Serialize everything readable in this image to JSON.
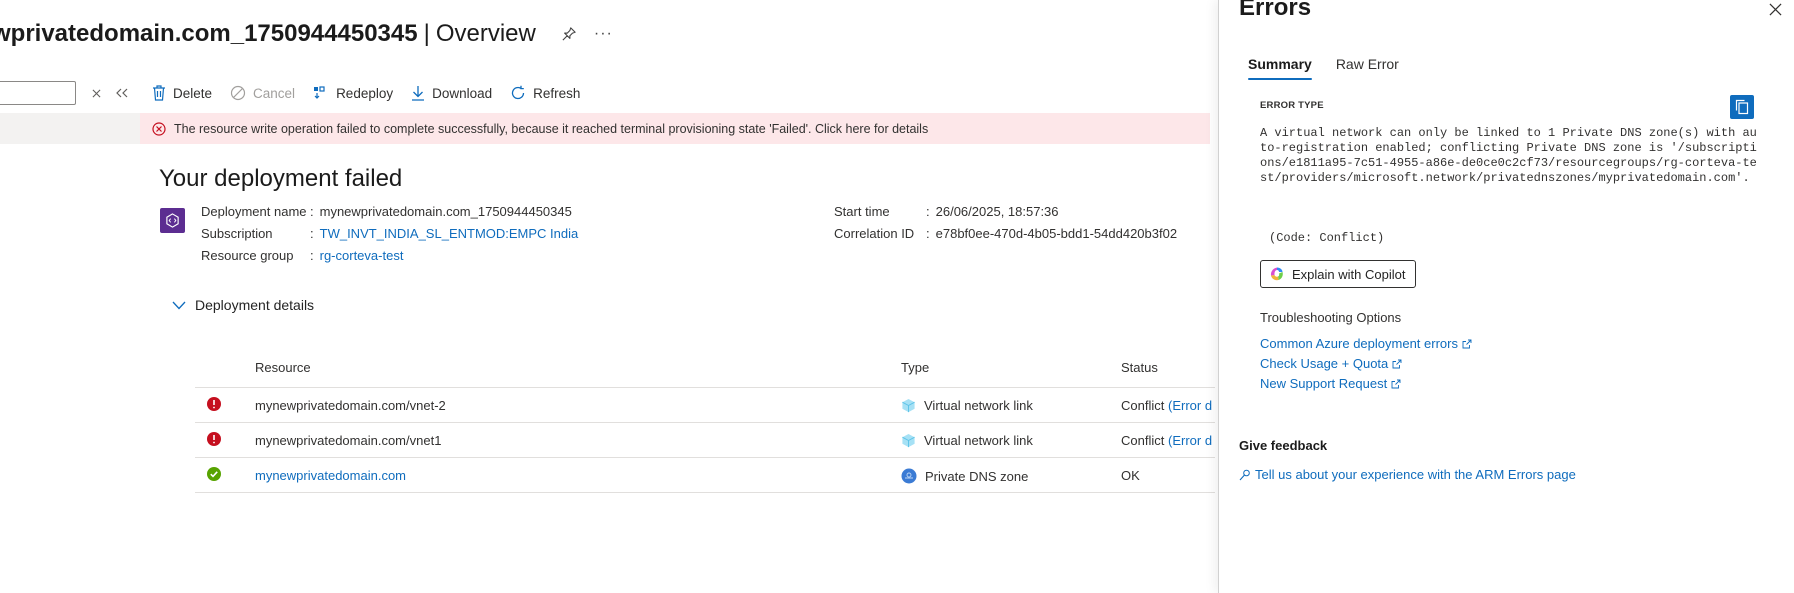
{
  "header": {
    "title": "wprivatedomain.com_1750944450345",
    "separator": "|",
    "subtitle": "Overview",
    "more": "···"
  },
  "toolbar": {
    "delete": "Delete",
    "cancel": "Cancel",
    "redeploy": "Redeploy",
    "download": "Download",
    "refresh": "Refresh"
  },
  "banner": {
    "message": "The resource write operation failed to complete successfully, because it reached terminal provisioning state 'Failed'. Click here for details"
  },
  "deployment": {
    "status_title": "Your deployment failed",
    "name_label": "Deployment name",
    "name_value": "mynewprivatedomain.com_1750944450345",
    "subscription_label": "Subscription",
    "subscription_value": "TW_INVT_INDIA_SL_ENTMOD:EMPC India",
    "rg_label": "Resource group",
    "rg_value": "rg-corteva-test",
    "start_label": "Start time",
    "start_value": "26/06/2025, 18:57:36",
    "corr_label": "Correlation ID",
    "corr_value": "e78bf0ee-470d-4b05-bdd1-54dd420b3f02",
    "colon": ":"
  },
  "details": {
    "toggle_label": "Deployment details",
    "columns": {
      "resource": "Resource",
      "type": "Type",
      "status": "Status"
    },
    "rows": [
      {
        "resource": "mynewprivatedomain.com/vnet-2",
        "type": "Virtual network link",
        "status": "Conflict",
        "status_link": "(Error d",
        "state": "error"
      },
      {
        "resource": "mynewprivatedomain.com/vnet1",
        "type": "Virtual network link",
        "status": "Conflict",
        "status_link": "(Error d",
        "state": "error"
      },
      {
        "resource": "mynewprivatedomain.com",
        "type": "Private DNS zone",
        "status": "OK",
        "status_link": "",
        "state": "ok"
      }
    ]
  },
  "panel": {
    "title": "Errors",
    "tabs": [
      "Summary",
      "Raw Error"
    ],
    "error_type_label": "ERROR TYPE",
    "error_message": "A virtual network can only be linked to 1 Private DNS zone(s) with auto-registration enabled; conflicting Private DNS zone is '/subscriptions/e1811a95-7c51-4955-a86e-de0ce0c2cf73/resourcegroups/rg-corteva-test/providers/microsoft.network/privatednszones/myprivatedomain.com'.",
    "error_code": "(Code: Conflict)",
    "copilot_button": "Explain with Copilot",
    "troubleshooting_label": "Troubleshooting Options",
    "troubleshooting_links": [
      "Common Azure deployment errors",
      "Check Usage + Quota",
      "New Support Request"
    ],
    "feedback_label": "Give feedback",
    "feedback_link": "Tell us about your experience with the ARM Errors page"
  },
  "colors": {
    "accent": "#0f6cbd",
    "error": "#c50f1f",
    "success": "#57a300",
    "banner_bg": "#fde7e9",
    "deployment_icon": "#5c2d91"
  }
}
